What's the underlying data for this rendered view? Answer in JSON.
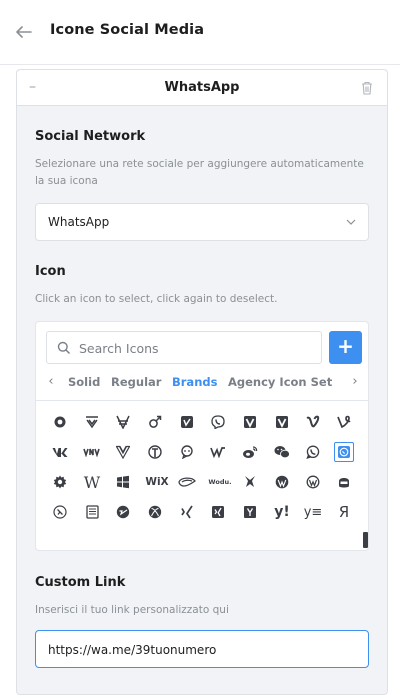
{
  "header": {
    "title": "Icone Social Media"
  },
  "panel": {
    "title": "WhatsApp",
    "social_network": {
      "label": "Social Network",
      "help": "Selezionare una rete sociale per aggiungere automaticamente la sua icona",
      "selected": "WhatsApp"
    },
    "icon": {
      "label": "Icon",
      "help": "Click an icon to select, click again to deselect.",
      "search_placeholder": "Search Icons",
      "tabs": [
        "Solid",
        "Regular",
        "Brands",
        "Agency Icon Set"
      ],
      "active_tab": "Brands",
      "brand_icons": [
        "viadeo-alt",
        "vimeo-alt",
        "viacoin",
        "venus-mars",
        "vimeo-square",
        "viber",
        "vimeo-box",
        "vimeo-square-alt",
        "vimeo-v",
        "vine",
        "vk",
        "vnv",
        "vuejs",
        "weebly",
        "weixin-alt",
        "webflow",
        "weibo",
        "weixin",
        "whatsapp",
        "whatsapp-square",
        "whmcs",
        "wikipedia-w",
        "windows",
        "wix",
        "wizards-of-the-coast",
        "wodu",
        "wolf-pack-battalion",
        "wordpress",
        "wordpress-simple",
        "wpbeginner",
        "wpexplorer",
        "wpforms",
        "wpressr",
        "xbox",
        "xing",
        "xing-square",
        "y-combinator",
        "yahoo",
        "yammer",
        "yandex"
      ]
    },
    "custom_link": {
      "label": "Custom Link",
      "help": "Inserisci il tuo link personalizzato qui",
      "value": "https://wa.me/39tuonumero"
    }
  },
  "colors": {
    "accent": "#3d8ff0",
    "panel_bg": "#f1f3f6",
    "border": "#dde1e6",
    "icon": "#3b3f45"
  }
}
